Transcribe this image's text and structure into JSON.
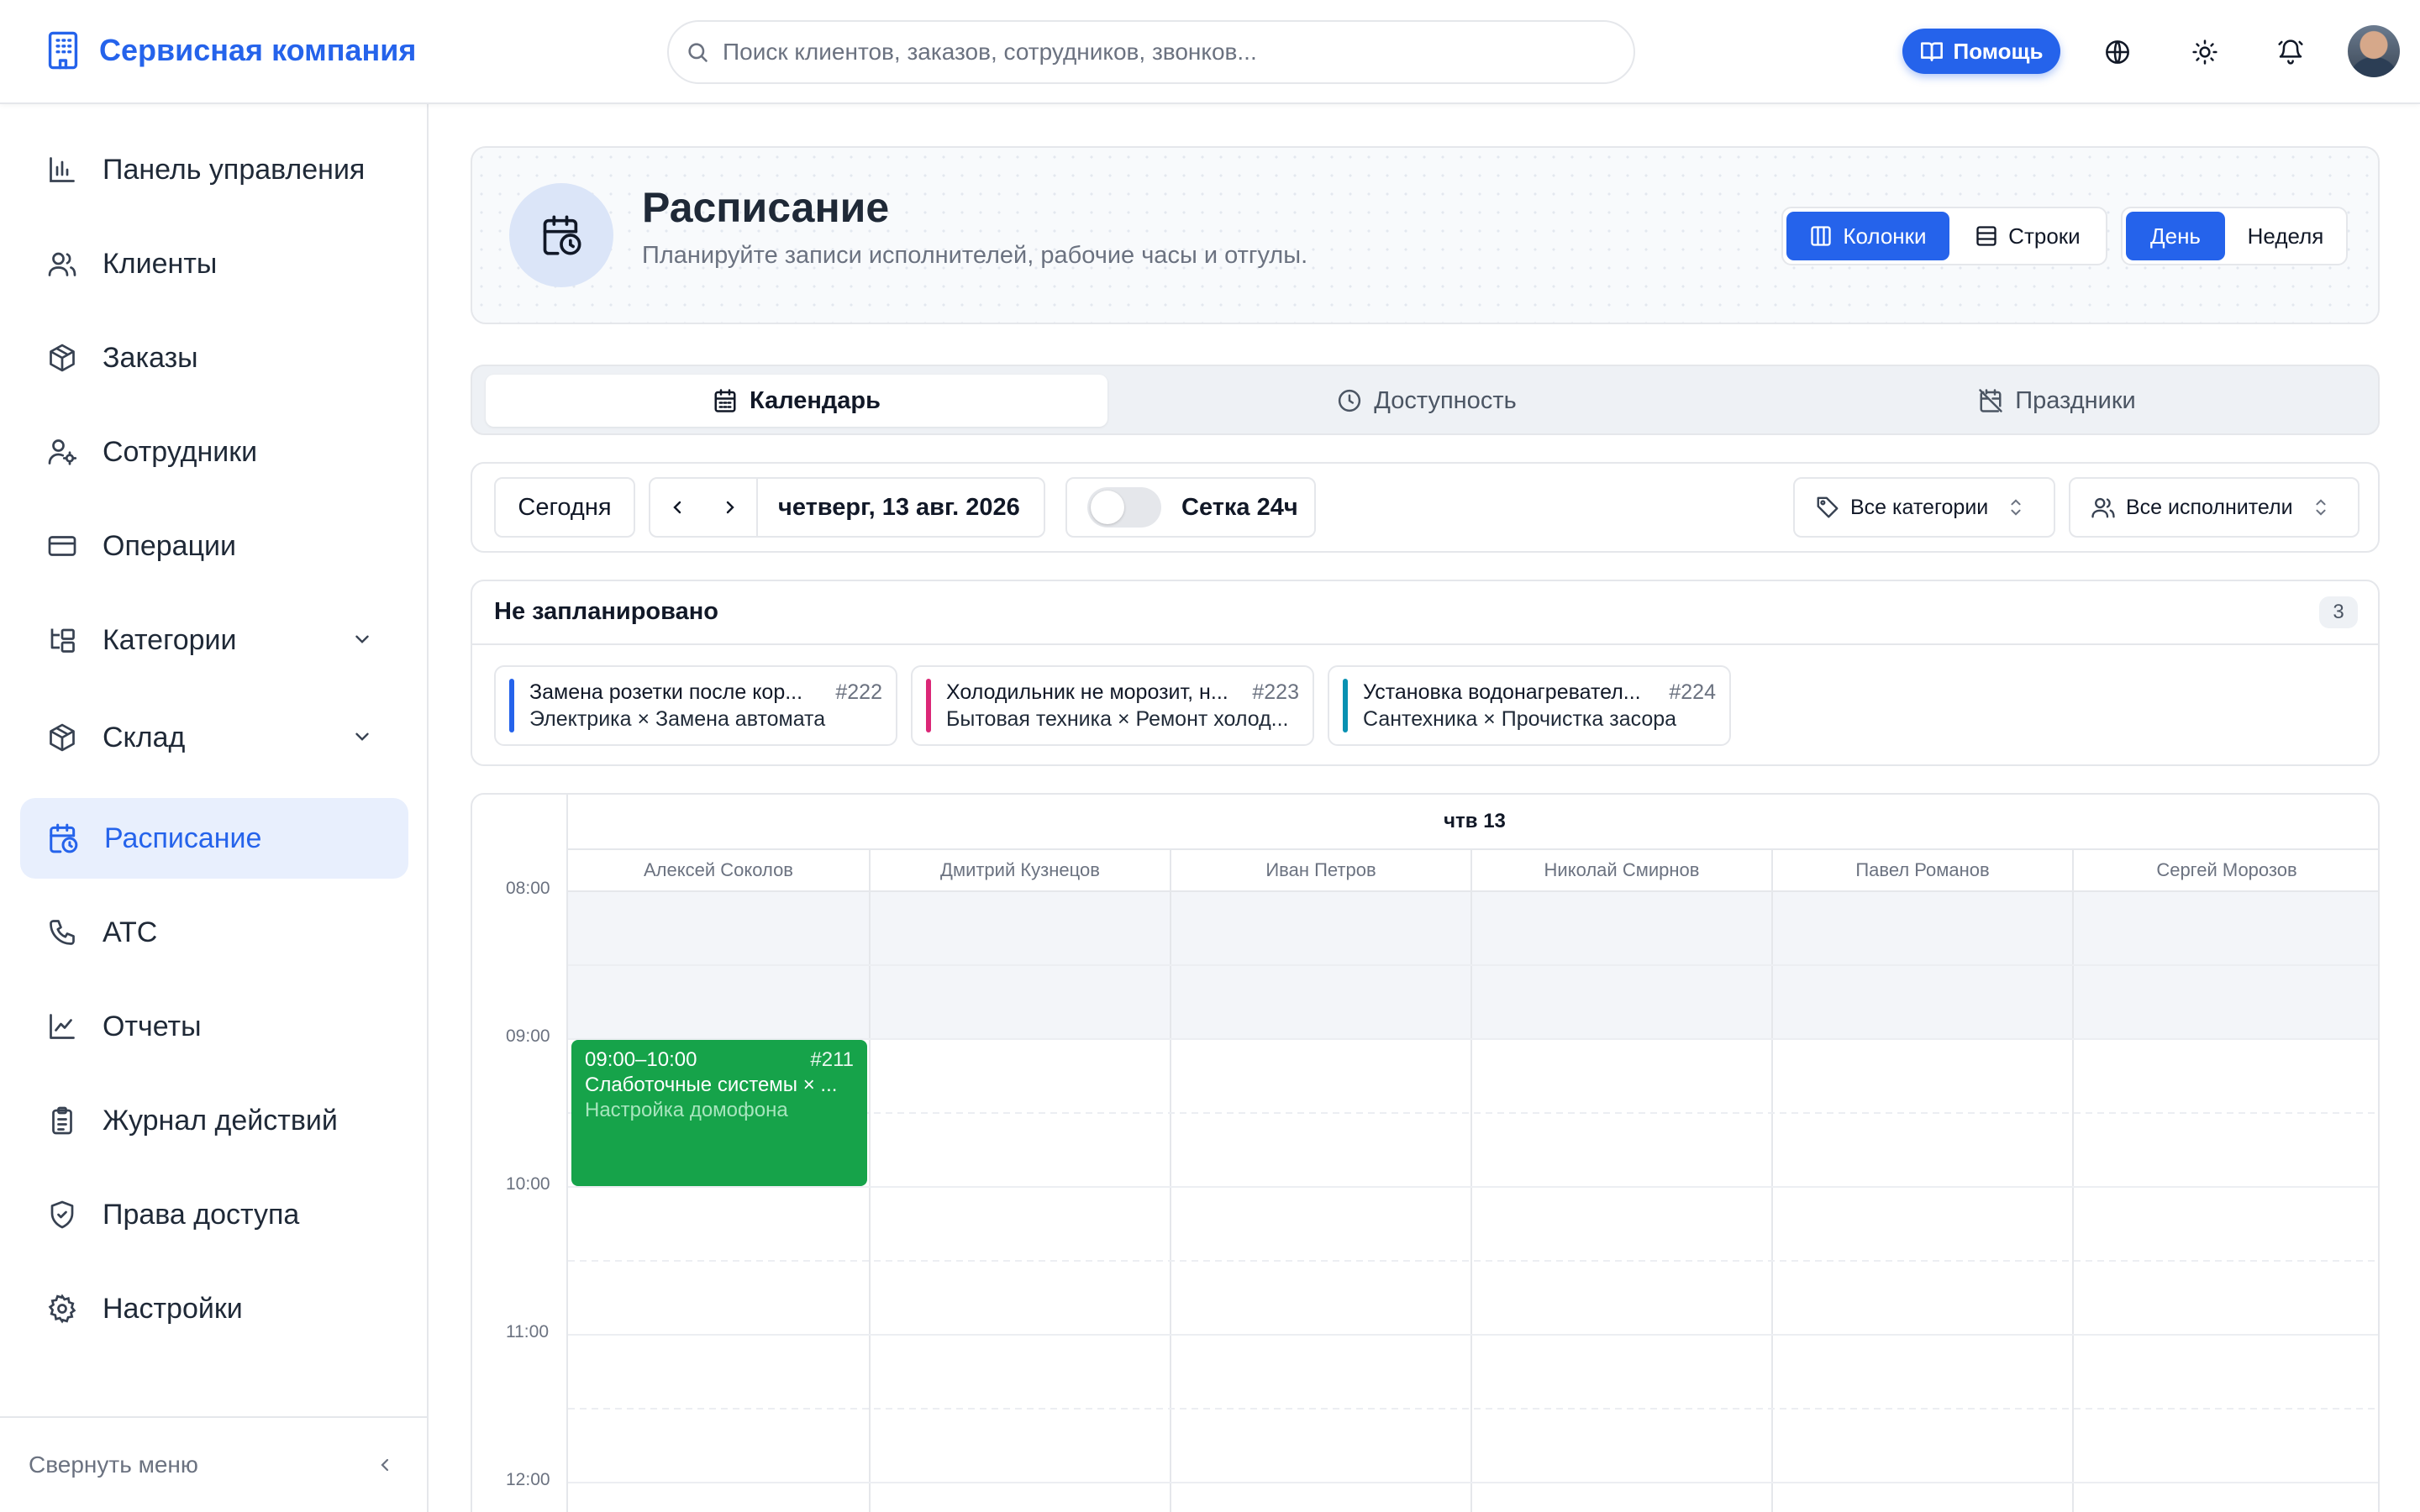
{
  "app": {
    "title": "Сервисная компания"
  },
  "search": {
    "placeholder": "Поиск клиентов, заказов, сотрудников, звонков..."
  },
  "topbar": {
    "help_label": "Помощь",
    "icons": [
      "globe-icon",
      "sun-icon",
      "bell-icon"
    ]
  },
  "sidebar": {
    "items": [
      {
        "label": "Панель управления",
        "icon": "bar-chart-icon"
      },
      {
        "label": "Клиенты",
        "icon": "users-icon"
      },
      {
        "label": "Заказы",
        "icon": "package-icon"
      },
      {
        "label": "Сотрудники",
        "icon": "user-gear-icon"
      },
      {
        "label": "Операции",
        "icon": "credit-card-icon"
      },
      {
        "label": "Категории",
        "icon": "tree-icon",
        "expandable": true
      },
      {
        "label": "Склад",
        "icon": "package-icon",
        "expandable": true
      },
      {
        "label": "Расписание",
        "icon": "calendar-clock-icon",
        "active": true
      },
      {
        "label": "АТС",
        "icon": "phone-icon"
      },
      {
        "label": "Отчеты",
        "icon": "line-chart-icon"
      },
      {
        "label": "Журнал действий",
        "icon": "clipboard-icon"
      },
      {
        "label": "Права доступа",
        "icon": "shield-icon"
      },
      {
        "label": "Настройки",
        "icon": "gear-icon"
      }
    ],
    "collapse_label": "Свернуть меню"
  },
  "header": {
    "title": "Расписание",
    "subtitle": "Планируйте записи исполнителей, рабочие часы и отгулы.",
    "layout_toggle": {
      "columns": "Колонки",
      "rows": "Строки",
      "selected": "Колонки"
    },
    "range_toggle": {
      "day": "День",
      "week": "Неделя",
      "selected": "День"
    }
  },
  "tabs": [
    {
      "label": "Календарь",
      "icon": "calendar-icon",
      "active": true
    },
    {
      "label": "Доступность",
      "icon": "clock-icon",
      "active": false
    },
    {
      "label": "Праздники",
      "icon": "calendar-off-icon",
      "active": false
    }
  ],
  "toolbar": {
    "today": "Сегодня",
    "date": "четверг, 13 авг. 2026",
    "grid_label": "Сетка 24ч",
    "grid_on": false,
    "category_filter": "Все категории",
    "executor_filter": "Все исполнители"
  },
  "unscheduled": {
    "title": "Не запланировано",
    "count": "3",
    "items": [
      {
        "title": "Замена розетки после кор...",
        "number": "#222",
        "subtitle": "Электрика × Замена автомата",
        "color": "#2563eb"
      },
      {
        "title": "Холодильник не морозит, н...",
        "number": "#223",
        "subtitle": "Бытовая техника × Ремонт холод...",
        "color": "#db2777"
      },
      {
        "title": "Установка водонагревател...",
        "number": "#224",
        "subtitle": "Сантехника × Прочистка засора",
        "color": "#0891b2"
      }
    ]
  },
  "calendar": {
    "day_label": "чтв 13",
    "columns": [
      "Алексей Соколов",
      "Дмитрий Кузнецов",
      "Иван Петров",
      "Николай Смирнов",
      "Павел Романов",
      "Сергей Морозов"
    ],
    "hours": [
      "08:00",
      "09:00",
      "10:00",
      "11:00",
      "12:00"
    ],
    "events": [
      {
        "column": "Алексей Соколов",
        "time": "09:00–10:00",
        "start": "09:00",
        "end": "10:00",
        "number": "#211",
        "title": "Слаботочные системы × ...",
        "subtitle": "Настройка домофона",
        "color": "#16a34a"
      }
    ]
  }
}
